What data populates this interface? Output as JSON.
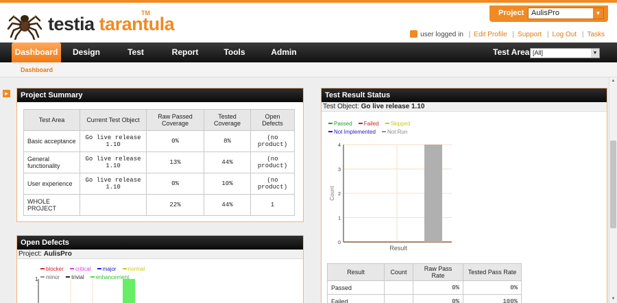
{
  "brand": {
    "name_part1": "testia",
    "name_part2": "tarantula",
    "tm": "TM"
  },
  "project": {
    "label": "Project",
    "selected": "AulisPro"
  },
  "user": {
    "status": "user logged in",
    "links": [
      "Edit Profile",
      "Support",
      "Log Out",
      "Tasks"
    ]
  },
  "nav": {
    "items": [
      "Dashboard",
      "Design",
      "Test",
      "Report",
      "Tools",
      "Admin"
    ],
    "active": "Dashboard"
  },
  "test_area": {
    "label": "Test Area",
    "selected": "[All]"
  },
  "subnav": {
    "item": "Dashboard"
  },
  "project_summary": {
    "title": "Project Summary",
    "headers": [
      "Test Area",
      "Current Test Object",
      "Raw Passed Coverage",
      "Tested Coverage",
      "Open Defects"
    ],
    "rows": [
      [
        "Basic acceptance",
        "Go live release 1.10",
        "0%",
        "8%",
        "(no product)"
      ],
      [
        "General functionality",
        "Go live release 1.10",
        "13%",
        "44%",
        "(no product)"
      ],
      [
        "User experience",
        "Go live release 1.10",
        "0%",
        "10%",
        "(no product)"
      ],
      [
        "WHOLE PROJECT",
        "",
        "22%",
        "44%",
        "1"
      ]
    ]
  },
  "open_defects": {
    "title": "Open Defects",
    "project_label": "Project:",
    "project_value": "AulisPro",
    "legend": [
      {
        "name": "blocker",
        "color": "#e02020"
      },
      {
        "name": "critical",
        "color": "#e040e0"
      },
      {
        "name": "major",
        "color": "#2020c0"
      },
      {
        "name": "normal",
        "color": "#c8c820"
      },
      {
        "name": "minor",
        "color": "#909090"
      },
      {
        "name": "trivial",
        "color": "#202020"
      },
      {
        "name": "enhancement",
        "color": "#40e040"
      }
    ],
    "ytick_top": "1"
  },
  "test_result": {
    "title": "Test Result Status",
    "object_label": "Test Object:",
    "object_value": "Go live release 1.10",
    "table_headers": [
      "Result",
      "Count",
      "Raw Pass Rate",
      "Tested Pass Rate"
    ],
    "table_rows": [
      [
        "Passed",
        "",
        "0%",
        "0%"
      ],
      [
        "Failed",
        "",
        "0%",
        "100%"
      ]
    ]
  },
  "chart_data": {
    "type": "bar",
    "categories": [
      "Passed",
      "Failed",
      "Skipped",
      "Not Implemented",
      "Not Run"
    ],
    "series": [
      {
        "name": "Passed",
        "color": "#20a020",
        "values": [
          0
        ]
      },
      {
        "name": "Failed",
        "color": "#d02020",
        "values": [
          0
        ]
      },
      {
        "name": "Skipped",
        "color": "#c8c820",
        "values": [
          0
        ]
      },
      {
        "name": "Not Implemented",
        "color": "#2020c0",
        "values": [
          0
        ]
      },
      {
        "name": "Not Run",
        "color": "#909090",
        "values": [
          4
        ]
      }
    ],
    "xlabel": "Result",
    "ylabel": "Count",
    "ylim": [
      0,
      4
    ],
    "yticks": [
      "0",
      "1",
      "2",
      "3",
      "4"
    ],
    "grid": true,
    "legend": "top-left"
  }
}
